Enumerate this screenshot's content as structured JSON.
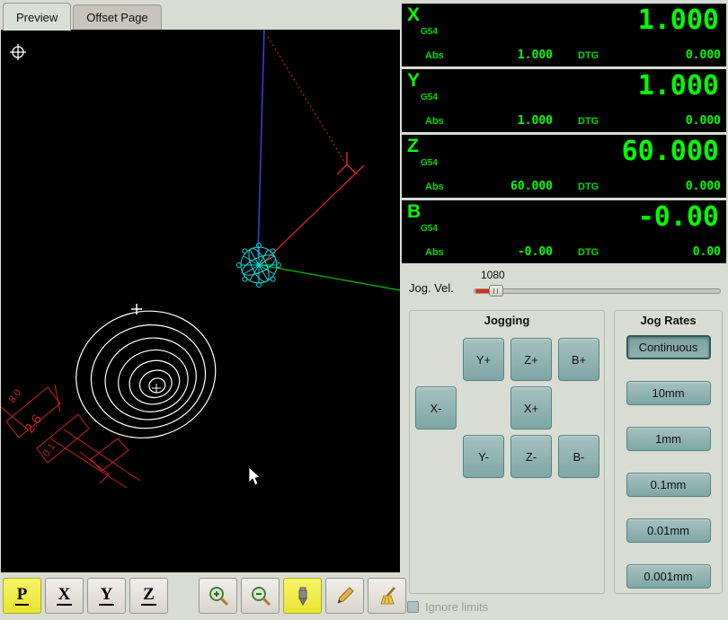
{
  "tabs": {
    "preview": "Preview",
    "offset": "Offset Page"
  },
  "dro": {
    "axes": [
      {
        "letter": "X",
        "system": "G54",
        "abs_label": "Abs",
        "abs": "1.000",
        "dtg_label": "DTG",
        "dtg": "0.000",
        "value": "1.000"
      },
      {
        "letter": "Y",
        "system": "G54",
        "abs_label": "Abs",
        "abs": "1.000",
        "dtg_label": "DTG",
        "dtg": "0.000",
        "value": "1.000"
      },
      {
        "letter": "Z",
        "system": "G54",
        "abs_label": "Abs",
        "abs": "60.000",
        "dtg_label": "DTG",
        "dtg": "0.000",
        "value": "60.000"
      },
      {
        "letter": "B",
        "system": "G54",
        "abs_label": "Abs",
        "abs": "-0.00",
        "dtg_label": "DTG",
        "dtg": "0.00",
        "value": "-0.00"
      }
    ]
  },
  "jog": {
    "vel_label": "Jog. Vel.",
    "vel_value": "1080",
    "jogging_title": "Jogging",
    "buttons": {
      "y_plus": "Y+",
      "z_plus": "Z+",
      "b_plus": "B+",
      "x_minus": "X-",
      "x_plus": "X+",
      "y_minus": "Y-",
      "z_minus": "Z-",
      "b_minus": "B-"
    },
    "rates_title": "Jog Rates",
    "rates": [
      "Continuous",
      "10mm",
      "1mm",
      "0.1mm",
      "0.01mm",
      "0.001mm"
    ],
    "active_rate": "Continuous"
  },
  "toolbar": {
    "p": "P",
    "x": "X",
    "y": "Y",
    "z": "Z"
  },
  "footer": {
    "ignore_limits": "Ignore limits"
  },
  "annotations": {
    "dim_a": "8.0",
    "dim_b": "2.6",
    "dim_c": "0.1"
  },
  "colors": {
    "dro_green": "#00ff00",
    "button_teal": "#7ea6a6",
    "active_yellow": "#efe94a",
    "canvas_red": "#cc2222",
    "canvas_cyan": "#00dddd",
    "canvas_green": "#00bb00",
    "canvas_blue": "#4040d8"
  }
}
